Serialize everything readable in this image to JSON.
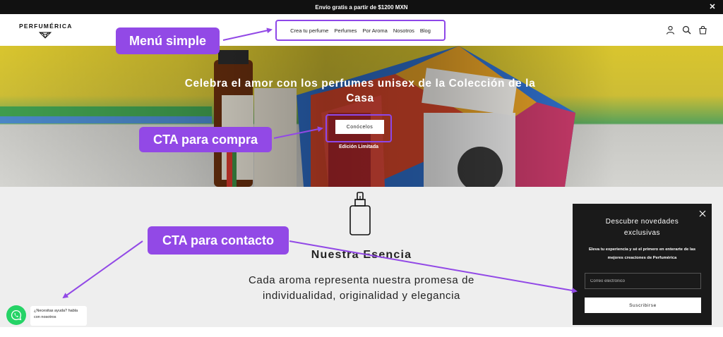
{
  "announcement": {
    "text": "Envío gratis a partir de $1200 MXN"
  },
  "header": {
    "logo": "PERFUMÉRICA",
    "nav": [
      {
        "label": "Crea tu perfume"
      },
      {
        "label": "Perfumes"
      },
      {
        "label": "Por Aroma"
      },
      {
        "label": "Nosotros"
      },
      {
        "label": "Blog"
      }
    ],
    "icons": [
      "account-icon",
      "search-icon",
      "cart-icon"
    ]
  },
  "hero": {
    "title": "Celebra el amor con los perfumes unisex de la Colección de la Casa",
    "cta_label": "Conócelos",
    "subtitle": "Edición Limitada"
  },
  "essence": {
    "title": "Nuestra Esencia",
    "text": "Cada aroma representa nuestra promesa de individualidad, originalidad y elegancia"
  },
  "whatsapp": {
    "text": "¿Necesitas ayuda? habla con nosotros"
  },
  "popup": {
    "title": "Descubre novedades exclusivas",
    "text": "Eleva tu experiencia y sé el primero en enterarte de las mejores creaciones de Perfumérica",
    "email_placeholder": "Correo electrónico",
    "button_label": "Suscribirse"
  },
  "annotations": {
    "menu": "Menú simple",
    "cta_compra": "CTA para compra",
    "cta_contacto": "CTA para contacto"
  },
  "colors": {
    "annotation": "#9249e6",
    "annotation_border": "#8e47e8",
    "topbar": "#111111",
    "popup_bg": "#1a1a1a",
    "whatsapp": "#25d366"
  }
}
